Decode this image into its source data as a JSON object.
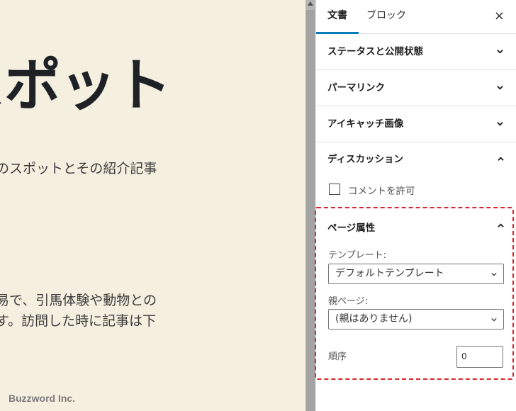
{
  "canvas": {
    "post_title": "スポット",
    "para1": "のスポットとその紹介記事",
    "para2": "易で、引馬体験や動物との",
    "para3": "す。訪問した時に記事は下",
    "watermark": "Buzzword Inc."
  },
  "sidebar": {
    "tabs": {
      "document": "文書",
      "block": "ブロック",
      "close": "×"
    },
    "panels": {
      "status": "ステータスと公開状態",
      "permalink": "パーマリンク",
      "featured_image": "アイキャッチ画像",
      "discussion": "ディスカッション"
    },
    "discussion": {
      "allow_comments": "コメントを許可"
    },
    "page_attributes": {
      "title": "ページ属性",
      "template_label": "テンプレート:",
      "template_value": "デフォルトテンプレート",
      "parent_label": "親ページ:",
      "parent_value": "(親はありません)",
      "order_label": "順序",
      "order_value": "0"
    }
  },
  "colors": {
    "canvas_bg": "#f5efe0",
    "accent": "#007cba",
    "highlight_border": "#d9262c"
  }
}
